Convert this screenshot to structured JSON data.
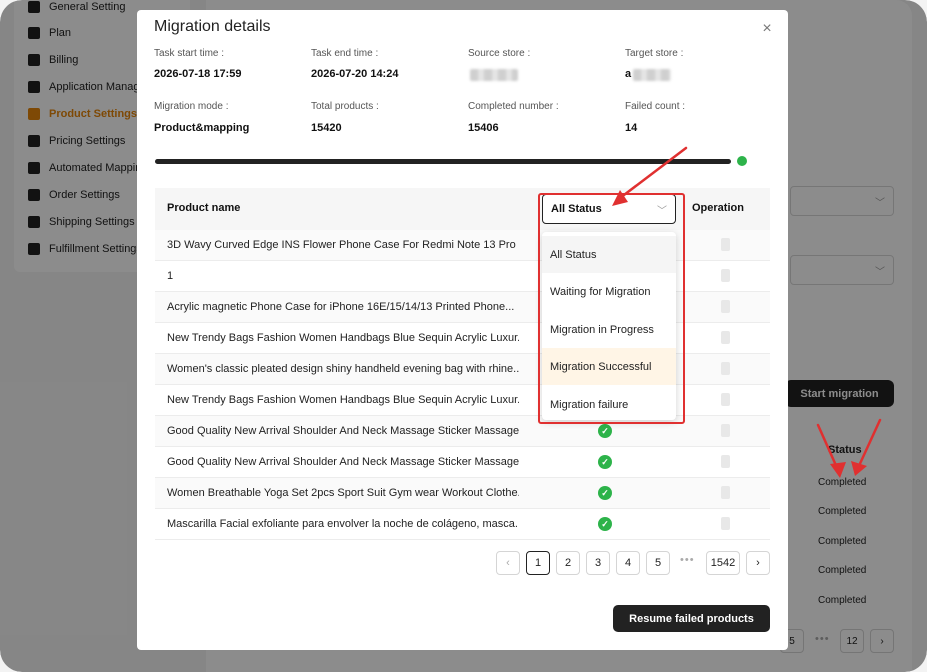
{
  "sidebar": {
    "items": [
      {
        "label": "General Setting",
        "icon": "gear-icon"
      },
      {
        "label": "Plan",
        "icon": "award-icon"
      },
      {
        "label": "Billing",
        "icon": "credit-card-icon"
      },
      {
        "label": "Application Management",
        "icon": "grid-icon"
      },
      {
        "label": "Product Settings",
        "icon": "list-settings-icon"
      },
      {
        "label": "Pricing Settings",
        "icon": "dollar-icon"
      },
      {
        "label": "Automated Mapping",
        "icon": "network-icon"
      },
      {
        "label": "Order Settings",
        "icon": "clipboard-icon"
      },
      {
        "label": "Shipping Settings",
        "icon": "truck-icon"
      },
      {
        "label": "Fulfillment Settings",
        "icon": "document-icon"
      }
    ],
    "active_index": 4
  },
  "background": {
    "start_button": "Start migration",
    "status_header": "Status",
    "status_values": [
      "Completed",
      "Completed",
      "Completed",
      "Completed",
      "Completed"
    ],
    "pager": {
      "partial_page": "5",
      "last_page": "12",
      "next": "›",
      "ellipsis": "•••"
    }
  },
  "modal": {
    "title": "Migration details",
    "close": "×",
    "info": {
      "task_start_label": "Task start time :",
      "task_start_value": "2026-07-18 17:59",
      "task_end_label": "Task end time :",
      "task_end_value": "2026-07-20 14:24",
      "source_store_label": "Source store :",
      "target_store_label": "Target store :",
      "target_store_prefix": "a",
      "mode_label": "Migration mode :",
      "mode_value": "Product&mapping",
      "total_label": "Total products :",
      "total_value": "15420",
      "completed_label": "Completed number :",
      "completed_value": "15406",
      "failed_label": "Failed count :",
      "failed_value": "14"
    },
    "progress": 1.0,
    "table": {
      "col_product": "Product name",
      "col_operation": "Operation",
      "rows": [
        "3D Wavy Curved Edge INS Flower Phone Case For Redmi Note 13 Pro 4...",
        "1",
        "Acrylic magnetic Phone Case for iPhone 16E/15/14/13 Printed Phone...",
        "New Trendy Bags Fashion Women Handbags Blue Sequin Acrylic Luxur...",
        "Women's classic pleated design shiny handheld evening bag with rhine...",
        "New Trendy Bags Fashion Women Handbags Blue Sequin Acrylic Luxur...",
        "Good Quality New Arrival Shoulder And Neck Massage Sticker Massage ...",
        "Good Quality New Arrival Shoulder And Neck Massage Sticker Massage ...",
        "Women Breathable Yoga Set 2pcs Sport Suit Gym wear Workout Clothe...",
        "Mascarilla Facial exfoliante para envolver la noche de colágeno, masca..."
      ]
    },
    "status_filter": {
      "selected": "All Status",
      "options": [
        "All Status",
        "Waiting for Migration",
        "Migration in Progress",
        "Migration Successful",
        "Migration failure"
      ]
    },
    "pager": {
      "prev": "‹",
      "pages": [
        "1",
        "2",
        "3",
        "4",
        "5"
      ],
      "ellipsis": "•••",
      "last": "1542",
      "next": "›",
      "current": "1"
    },
    "resume_button": "Resume failed products"
  },
  "colors": {
    "accent_orange": "#e6850a",
    "success_green": "#2db34a",
    "annotation_red": "#e03030",
    "dark_button": "#222222"
  }
}
